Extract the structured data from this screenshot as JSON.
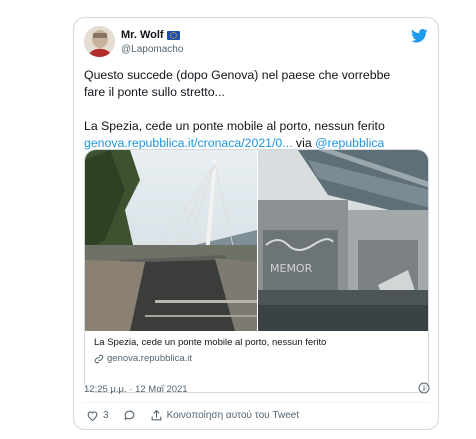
{
  "tweet": {
    "author": {
      "display_name": "Mr. Wolf",
      "handle": "@Lapomacho",
      "badge_icon": "eu-flag-icon"
    },
    "text_line1": "Questo succede (dopo Genova) nel paese che vorrebbe",
    "text_line2": "fare il ponte sullo stretto...",
    "text_line3": "La Spezia, cede un ponte mobile al porto, nessun ferito",
    "link_text": "genova.repubblica.it/cronaca/2021/0...",
    "via_text": " via ",
    "mention": "@repubblica",
    "timestamp": "12:25 μ.μ. · 12 Μαΐ 2021",
    "likes_count": "3",
    "share_label": "Κοινοποίηση αυτού του Tweet"
  },
  "link_card": {
    "title": "La Spezia, cede un ponte mobile al porto, nessun ferito",
    "domain": "genova.repubblica.it"
  },
  "colors": {
    "link": "#1b95e0",
    "twitter_blue": "#1d9bf0",
    "secondary_text": "#536471",
    "like_red": "#f91880"
  }
}
